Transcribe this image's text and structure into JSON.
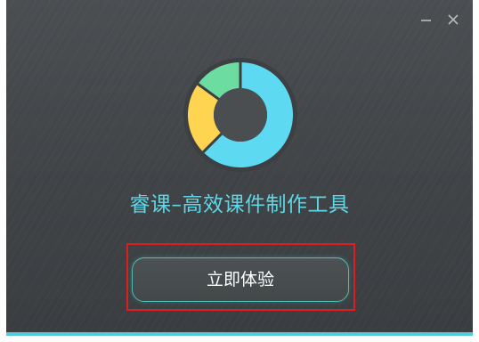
{
  "window": {
    "minimize_icon": "minimize-icon",
    "close_icon": "close-icon"
  },
  "logo": {
    "icon": "donut-chart-logo",
    "colors": {
      "blue": "#5dd9f1",
      "yellow": "#ffd451",
      "green": "#6ddca0",
      "center": "#4a4e51"
    }
  },
  "app": {
    "title": "睿课–高效课件制作工具"
  },
  "cta": {
    "label": "立即体验"
  },
  "colors": {
    "background": "#424649",
    "title_text": "#5fd6e6",
    "button_border": "#4fb9b3",
    "highlight_frame": "#e11b22"
  }
}
